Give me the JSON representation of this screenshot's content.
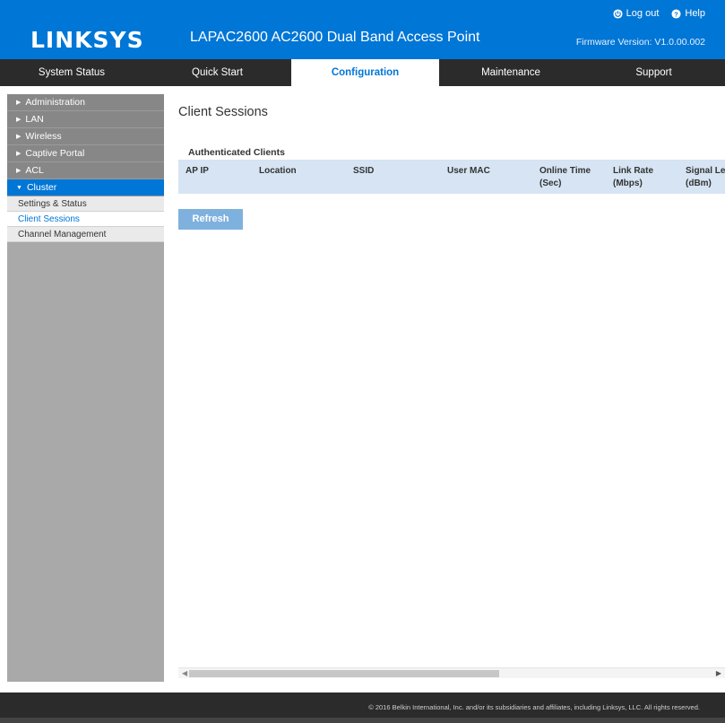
{
  "header": {
    "brand": "LINKSYS",
    "product_title": "LAPAC2600 AC2600 Dual Band Access Point",
    "logout_label": "Log out",
    "help_label": "Help",
    "firmware": "Firmware Version: V1.0.00.002"
  },
  "nav": [
    {
      "label": "System Status"
    },
    {
      "label": "Quick Start"
    },
    {
      "label": "Configuration",
      "active": true
    },
    {
      "label": "Maintenance"
    },
    {
      "label": "Support"
    }
  ],
  "sidebar": {
    "items": [
      {
        "label": "Administration"
      },
      {
        "label": "LAN"
      },
      {
        "label": "Wireless"
      },
      {
        "label": "Captive Portal"
      },
      {
        "label": "ACL"
      },
      {
        "label": "Cluster",
        "active": true
      }
    ],
    "sub_items": [
      {
        "label": "Settings & Status"
      },
      {
        "label": "Client Sessions",
        "active": true
      },
      {
        "label": "Channel Management"
      }
    ]
  },
  "main": {
    "title": "Client Sessions",
    "section_label": "Authenticated Clients",
    "columns": [
      {
        "line1": "AP IP",
        "line2": ""
      },
      {
        "line1": "Location",
        "line2": ""
      },
      {
        "line1": "SSID",
        "line2": ""
      },
      {
        "line1": "User MAC",
        "line2": ""
      },
      {
        "line1": "Online Time",
        "line2": "(Sec)"
      },
      {
        "line1": "Link Rate",
        "line2": "(Mbps)"
      },
      {
        "line1": "Signal Le",
        "line2": "(dBm)"
      }
    ],
    "refresh_label": "Refresh"
  },
  "footer": {
    "text": "© 2016 Belkin International, Inc. and/or its subsidiaries and affiliates, including Linksys, LLC. All rights reserved."
  },
  "colors": {
    "brand_blue": "#0076d6",
    "nav_bg": "#2b2b2b",
    "table_header_bg": "#d6e4f3",
    "button_bg": "#7fb1df"
  }
}
